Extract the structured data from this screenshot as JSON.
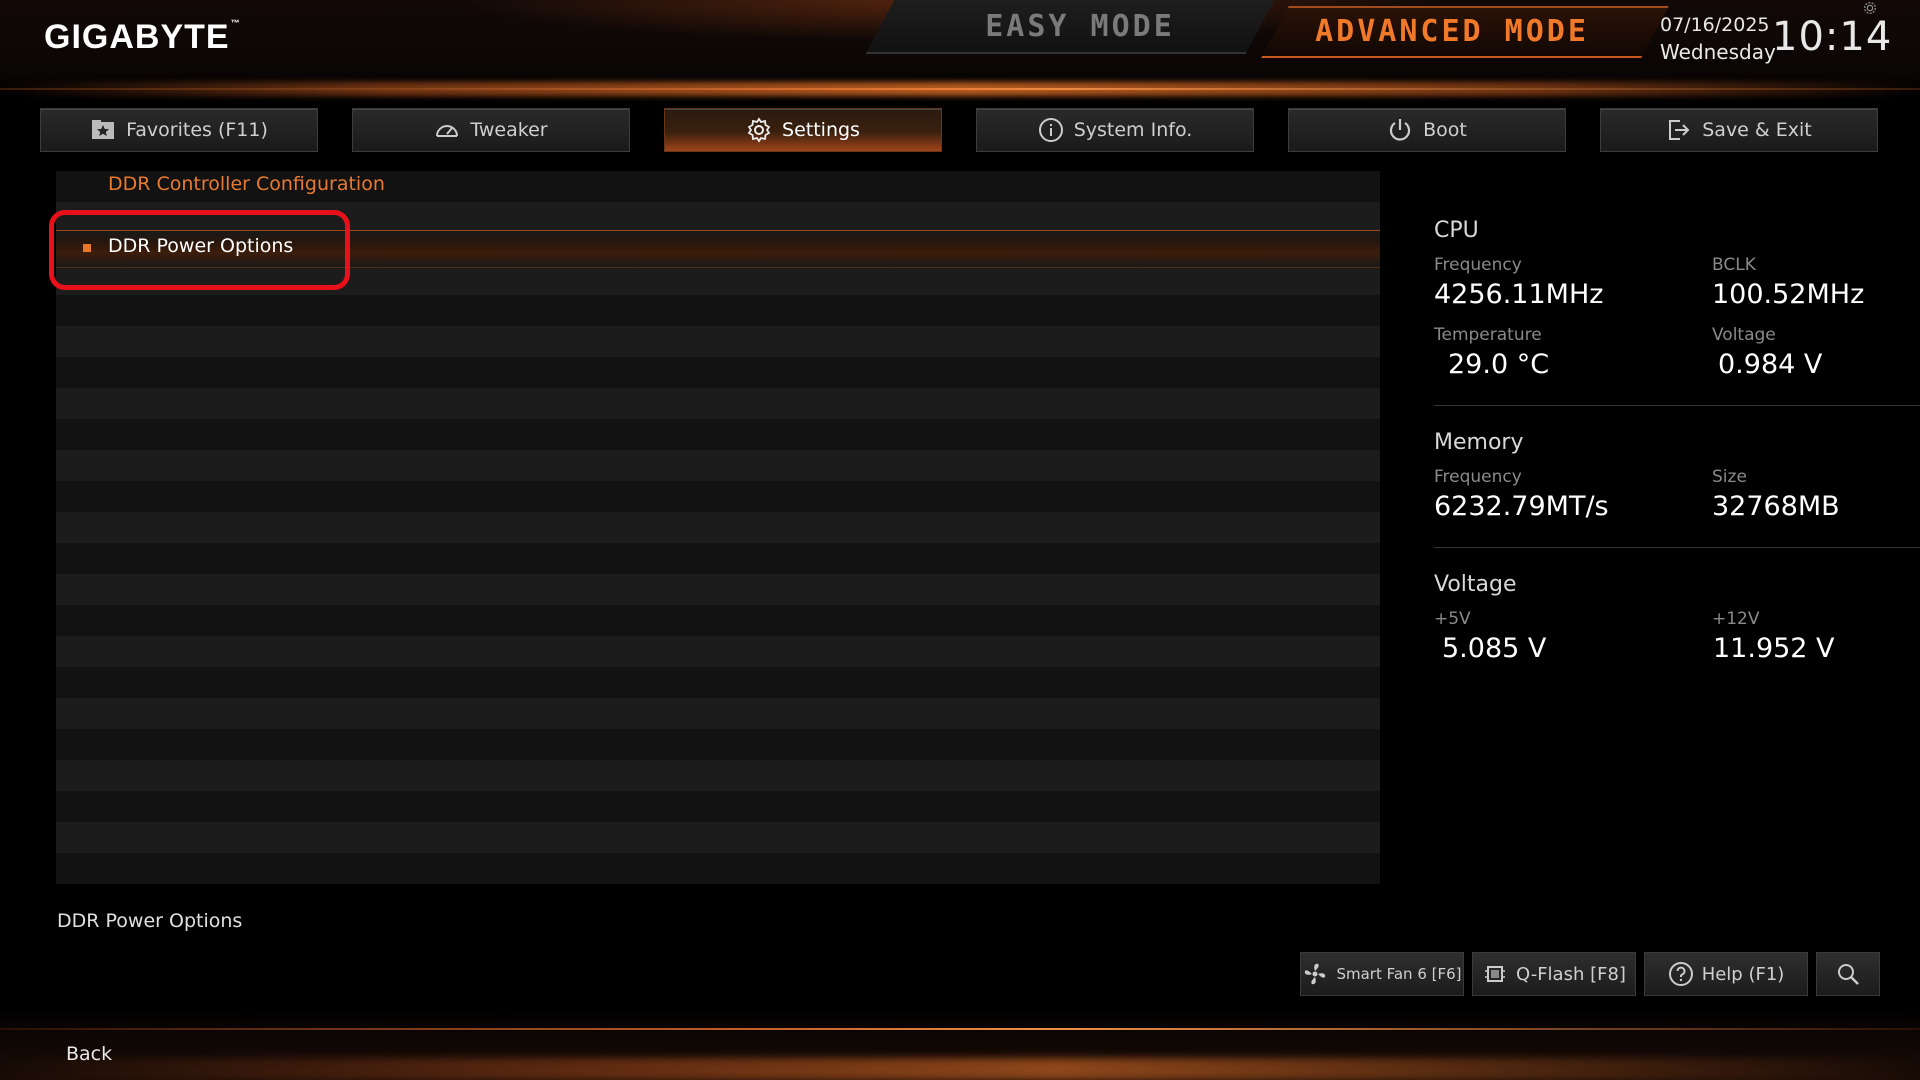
{
  "header": {
    "logo": "GIGABYTE",
    "logo_tm": "™",
    "easy_mode": "EASY MODE",
    "advanced_mode": "ADVANCED MODE",
    "date": "07/16/2025",
    "weekday": "Wednesday",
    "time": "10:14",
    "accent_color": "#f07a2a"
  },
  "tabs": [
    {
      "label": "Favorites (F11)",
      "icon": "favorites-star-icon",
      "active": false
    },
    {
      "label": "Tweaker",
      "icon": "speedometer-icon",
      "active": false
    },
    {
      "label": "Settings",
      "icon": "gear-icon",
      "active": true
    },
    {
      "label": "System Info.",
      "icon": "info-icon",
      "active": false
    },
    {
      "label": "Boot",
      "icon": "power-icon",
      "active": false
    },
    {
      "label": "Save & Exit",
      "icon": "exit-icon",
      "active": false
    }
  ],
  "main": {
    "breadcrumb": "DDR Controller Configuration",
    "items": [
      {
        "label": "DDR Power Options",
        "selected": true
      }
    ]
  },
  "info": {
    "cpu": {
      "title": "CPU",
      "frequency_label": "Frequency",
      "frequency": "4256.11MHz",
      "bclk_label": "BCLK",
      "bclk": "100.52MHz",
      "temperature_label": "Temperature",
      "temperature": "29.0 °C",
      "voltage_label": "Voltage",
      "voltage": "0.984 V"
    },
    "memory": {
      "title": "Memory",
      "frequency_label": "Frequency",
      "frequency": "6232.79MT/s",
      "size_label": "Size",
      "size": "32768MB"
    },
    "voltage": {
      "title": "Voltage",
      "v5_label": "+5V",
      "v5": "5.085 V",
      "v12_label": "+12V",
      "v12": "11.952 V"
    }
  },
  "footer": {
    "help_text": "DDR Power Options",
    "smart_fan": "Smart Fan 6 [F6]",
    "qflash": "Q-Flash [F8]",
    "help": "Help (F1)",
    "back": "Back"
  }
}
